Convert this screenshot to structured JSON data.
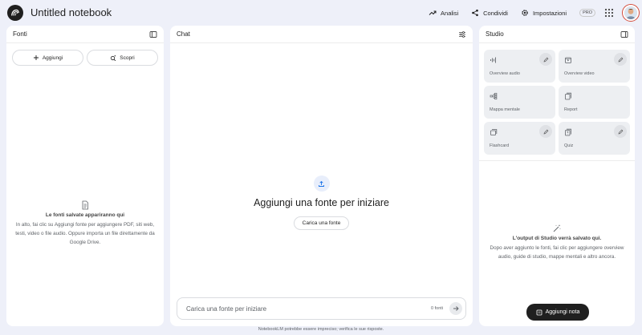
{
  "header": {
    "title": "Untitled notebook",
    "analytics_label": "Analisi",
    "share_label": "Condividi",
    "settings_label": "Impostazioni",
    "pro_badge": "PRO"
  },
  "sources": {
    "title": "Fonti",
    "add_label": "Aggiungi",
    "discover_label": "Scopri",
    "empty_title": "Le fonti salvate appariranno qui",
    "empty_body": "In alto, fai clic su Aggiungi fonte per aggiungere PDF, siti web, testi, video o file audio. Oppure importa un file direttamente da Google Drive."
  },
  "chat": {
    "title": "Chat",
    "heading": "Aggiungi una fonte per iniziare",
    "upload_button": "Carica una fonte",
    "input_placeholder": "Carica una fonte per iniziare",
    "source_count": "0 fonti"
  },
  "studio": {
    "title": "Studio",
    "cards": [
      {
        "label": "Overview audio",
        "icon": "audio-waveform-icon",
        "editable": true
      },
      {
        "label": "Overview video",
        "icon": "video-icon",
        "editable": true
      },
      {
        "label": "Mappa mentale",
        "icon": "mind-map-icon",
        "editable": false
      },
      {
        "label": "Report",
        "icon": "report-icon",
        "editable": false
      },
      {
        "label": "Flashcard",
        "icon": "flashcard-icon",
        "editable": true
      },
      {
        "label": "Quiz",
        "icon": "quiz-icon",
        "editable": true
      }
    ],
    "empty_title": "L'output di Studio verrà salvato qui.",
    "empty_body": "Dopo aver aggiunto le fonti, fai clic per aggiungere overview audio, guide di studio, mappe mentali e altro ancora.",
    "add_note_label": "Aggiungi nota"
  },
  "footer": "NotebookLM potrebbe essere impreciso; verifica le sue risposte.",
  "colors": {
    "background": "#eef0f9",
    "panel": "#ffffff",
    "accent_blue": "#1a73e8",
    "dark_button": "#1f1f1f",
    "card_bg": "#edeff2"
  }
}
